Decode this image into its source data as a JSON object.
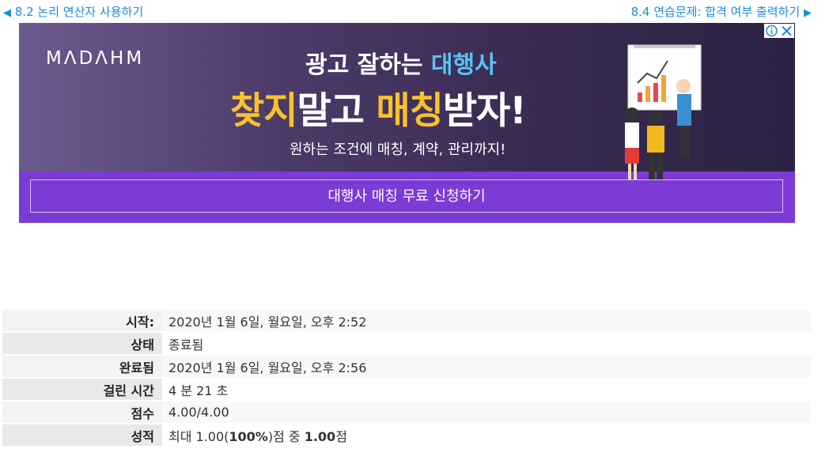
{
  "nav": {
    "prev_arrow": "◀",
    "prev_label": "8.2 논리 연산자 사용하기",
    "next_label": "8.4 연습문제: 합격 여부 출력하기",
    "next_arrow": "▶"
  },
  "ad": {
    "logo": "MΛDΛHM",
    "headline1_part1": "광고 잘하는 ",
    "headline1_part2": "대행사",
    "headline2_part1": "찾지",
    "headline2_part2": "말고 ",
    "headline2_part3": "매칭",
    "headline2_part4": "받자!",
    "subtitle": "원하는 조건에 매칭, 계약, 관리까지!",
    "cta_label": "대행사 매칭 무료 신청하기",
    "colors": {
      "accent_blue": "#55c3f2",
      "accent_yellow": "#f9c22b",
      "cta_bar": "#7b3bd4"
    }
  },
  "summary": {
    "rows": [
      {
        "label": "시작:",
        "value": "2020년 1월 6일, 월요일, 오후 2:52"
      },
      {
        "label": "상태",
        "value": "종료됨"
      },
      {
        "label": "완료됨",
        "value": "2020년 1월 6일, 월요일, 오후 2:56"
      },
      {
        "label": "걸린 시간",
        "value": "4 분 21 초"
      },
      {
        "label": "점수",
        "value": "4.00/4.00"
      }
    ],
    "grade": {
      "label": "성적",
      "prefix": "최대 1.00(",
      "percent": "100%",
      "middle": ")점 중 ",
      "score": "1.00",
      "suffix": "점"
    }
  }
}
